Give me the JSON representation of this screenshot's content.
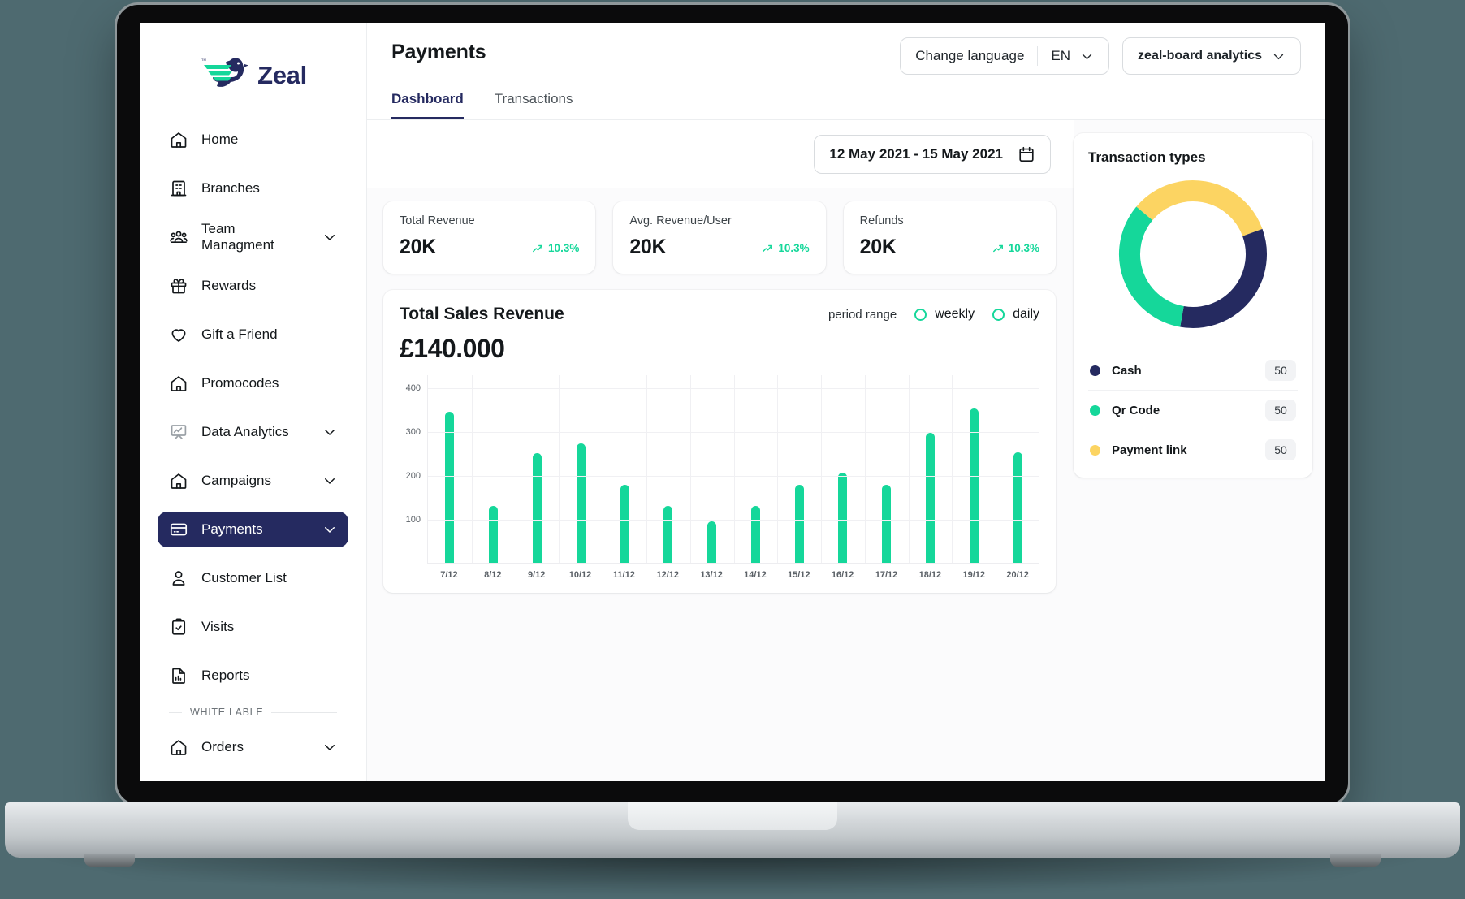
{
  "brand": {
    "name": "Zeal",
    "logo_icon": "zeal-bird-logo"
  },
  "colors": {
    "navy": "#252a60",
    "green": "#15d79a",
    "yellow": "#fcd462",
    "page_bg": "#4e6a70"
  },
  "sidebar": {
    "items": [
      {
        "label": "Home",
        "icon": "home-icon",
        "expandable": false,
        "active": false
      },
      {
        "label": "Branches",
        "icon": "building-icon",
        "expandable": false,
        "active": false
      },
      {
        "label": "Team Managment",
        "icon": "team-icon",
        "expandable": true,
        "active": false
      },
      {
        "label": "Rewards",
        "icon": "gift-icon",
        "expandable": false,
        "active": false
      },
      {
        "label": "Gift a Friend",
        "icon": "heart-icon",
        "expandable": false,
        "active": false
      },
      {
        "label": "Promocodes",
        "icon": "home-icon",
        "expandable": false,
        "active": false
      },
      {
        "label": "Data Analytics",
        "icon": "presentation-chart-icon",
        "expandable": true,
        "active": false
      },
      {
        "label": "Campaigns",
        "icon": "home-icon",
        "expandable": true,
        "active": false
      },
      {
        "label": "Payments",
        "icon": "credit-card-icon",
        "expandable": true,
        "active": true
      },
      {
        "label": "Customer List",
        "icon": "user-icon",
        "expandable": false,
        "active": false
      },
      {
        "label": "Visits",
        "icon": "clipboard-check-icon",
        "expandable": false,
        "active": false
      },
      {
        "label": "Reports",
        "icon": "report-bars-icon",
        "expandable": false,
        "active": false
      }
    ],
    "section_divider_label": "WHITE LABLE",
    "bottom_items": [
      {
        "label": "Orders",
        "icon": "home-icon",
        "expandable": true,
        "active": false
      }
    ]
  },
  "header": {
    "title": "Payments",
    "tabs": [
      {
        "label": "Dashboard",
        "active": true
      },
      {
        "label": "Transactions",
        "active": false
      }
    ],
    "language_selector": {
      "label": "Change language",
      "value": "EN",
      "chevron_icon": "chevron-down-icon"
    },
    "account_selector": {
      "label": "zeal-board analytics",
      "chevron_icon": "chevron-down-icon"
    }
  },
  "filters": {
    "date_range": "12 May 2021  -  15 May 2021",
    "calendar_icon": "calendar-icon"
  },
  "stats": [
    {
      "title": "Total Revenue",
      "value": "20K",
      "trend": "10.3%",
      "trend_icon": "trend-up-icon"
    },
    {
      "title": "Avg. Revenue/User",
      "value": "20K",
      "trend": "10.3%",
      "trend_icon": "trend-up-icon"
    },
    {
      "title": "Refunds",
      "value": "20K",
      "trend": "10.3%",
      "trend_icon": "trend-up-icon"
    }
  ],
  "sales": {
    "title": "Total Sales Revenue",
    "total": "£140.000",
    "period_label": "period range",
    "options": [
      {
        "label": "weekly",
        "selected": false
      },
      {
        "label": "daily",
        "selected": false
      }
    ]
  },
  "transaction_types": {
    "title": "Transaction types",
    "legend": [
      {
        "name": "Cash",
        "value": "50",
        "color": "#252a60"
      },
      {
        "name": "Qr Code",
        "value": "50",
        "color": "#15d79a"
      },
      {
        "name": "Payment link",
        "value": "50",
        "color": "#fcd462"
      }
    ]
  },
  "chart_data": [
    {
      "type": "bar",
      "title": "Total Sales Revenue",
      "xlabel": "",
      "ylabel": "",
      "ylim": [
        0,
        430
      ],
      "yticks": [
        100,
        200,
        300,
        400
      ],
      "grid": true,
      "categories": [
        "7/12",
        "8/12",
        "9/12",
        "10/12",
        "11/12",
        "12/12",
        "13/12",
        "14/12",
        "15/12",
        "16/12",
        "17/12",
        "18/12",
        "19/12",
        "20/12"
      ],
      "values": [
        345,
        130,
        250,
        272,
        178,
        130,
        95,
        130,
        178,
        205,
        178,
        297,
        352,
        252
      ],
      "series_color": "#15d79a"
    },
    {
      "type": "pie",
      "title": "Transaction types",
      "labels": [
        "Cash",
        "Qr Code",
        "Payment link"
      ],
      "values": [
        50,
        50,
        50
      ],
      "colors": [
        "#252a60",
        "#15d79a",
        "#fcd462"
      ],
      "legend": "bottom",
      "donut": true
    }
  ]
}
